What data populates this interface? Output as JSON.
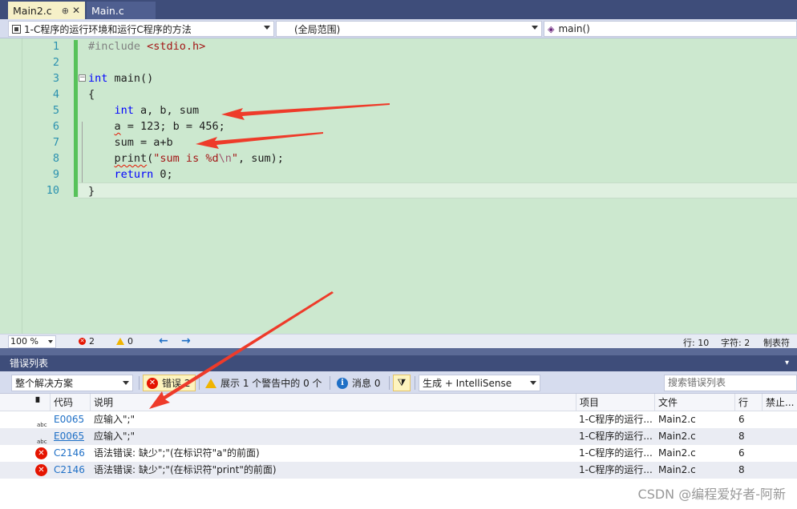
{
  "tabs": [
    {
      "label": "Main2.c",
      "pin": "⊕",
      "close": "✕",
      "active": true
    },
    {
      "label": "Main.c",
      "active": false
    }
  ],
  "navbar": {
    "project": "1-C程序的运行环境和运行C程序的方法",
    "scope": "(全局范围)",
    "member": "main()"
  },
  "editor": {
    "line_numbers": [
      "1",
      "2",
      "3",
      "4",
      "5",
      "6",
      "7",
      "8",
      "9",
      "10"
    ],
    "code": {
      "l1_pp": "#include ",
      "l1_inc": "<stdio.h>",
      "l3_kw": "int",
      "l3_fn": " main()",
      "l4": "{",
      "l5_kw": "int",
      "l5_rest": " a, b, sum",
      "l6_a": "a",
      "l6_rest": " = 123; b = 456;",
      "l7": "sum = a+b",
      "l8_fn": "print",
      "l8_open": "(",
      "l8_str1": "\"sum is %d",
      "l8_esc": "\\n",
      "l8_str2": "\"",
      "l8_rest": ", sum);",
      "l9_kw": "return",
      "l9_rest": " 0;",
      "l10": "}"
    },
    "collapse_glyph": "−"
  },
  "editor_status": {
    "zoom": "100 %",
    "errors": "2",
    "warnings": "0",
    "prev": "←",
    "next": "→",
    "line": "行: 10",
    "char": "字符: 2",
    "tabs": "制表符"
  },
  "error_list": {
    "title": "错误列表",
    "menu": "▾",
    "scope": "整个解决方案",
    "errors_btn": "错误 2",
    "warnings_btn": "展示 1 个警告中的 0 个",
    "messages_btn": "消息 0",
    "build_filter": "生成 + IntelliSense",
    "search_placeholder": "搜索错误列表",
    "columns": {
      "code": "代码",
      "description": "说明",
      "project": "项目",
      "file": "文件",
      "line": "行",
      "suppress": "禁止..."
    },
    "rows": [
      {
        "icon": "abc",
        "code": "E0065",
        "description": "应输入\";\"",
        "project": "1-C程序的运行...",
        "file": "Main2.c",
        "line": "6"
      },
      {
        "icon": "abc",
        "code": "E0065",
        "description": "应输入\";\"",
        "project": "1-C程序的运行...",
        "file": "Main2.c",
        "line": "8"
      },
      {
        "icon": "x",
        "code": "C2146",
        "description": "语法错误: 缺少\";\"(在标识符\"a\"的前面)",
        "project": "1-C程序的运行...",
        "file": "Main2.c",
        "line": "6"
      },
      {
        "icon": "x",
        "code": "C2146",
        "description": "语法错误: 缺少\";\"(在标识符\"print\"的前面)",
        "project": "1-C程序的运行...",
        "file": "Main2.c",
        "line": "8"
      }
    ]
  },
  "watermark": "CSDN @编程爱好者-阿新",
  "colors": {
    "annotation_arrow": "#ee3b2a",
    "editor_bg": "#cce8cf",
    "change_bar": "#57c25a",
    "error_red": "#e51400"
  }
}
